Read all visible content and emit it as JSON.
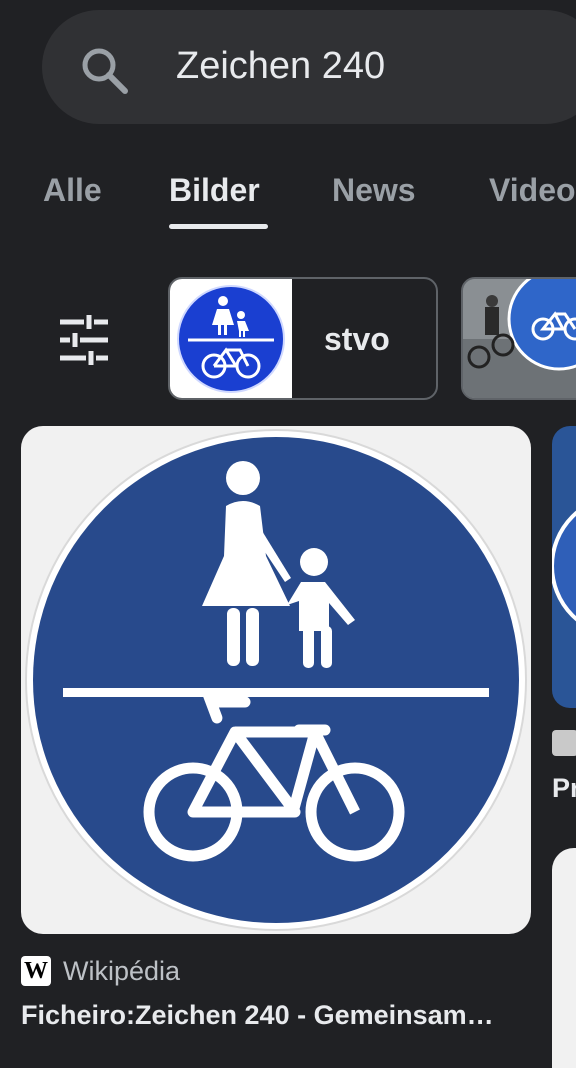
{
  "search": {
    "query": "Zeichen 240",
    "icon": "search-icon"
  },
  "tabs": [
    {
      "label": "Alle",
      "active": false
    },
    {
      "label": "Bilder",
      "active": true
    },
    {
      "label": "News",
      "active": false
    },
    {
      "label": "Video",
      "active": false
    }
  ],
  "filters": {
    "icon": "tune-icon",
    "chips": [
      {
        "label": "stvo"
      }
    ]
  },
  "results": [
    {
      "source": "Wikipédia",
      "source_icon": "wikipedia-w-icon",
      "source_letter": "W",
      "title": "Ficheiro:Zeichen 240 - Gemeinsam…"
    },
    {
      "title": "Pr"
    }
  ],
  "colors": {
    "background": "#202124",
    "search_bar": "#303134",
    "sign_blue": "#284a8c",
    "sign_white": "#ffffff"
  }
}
